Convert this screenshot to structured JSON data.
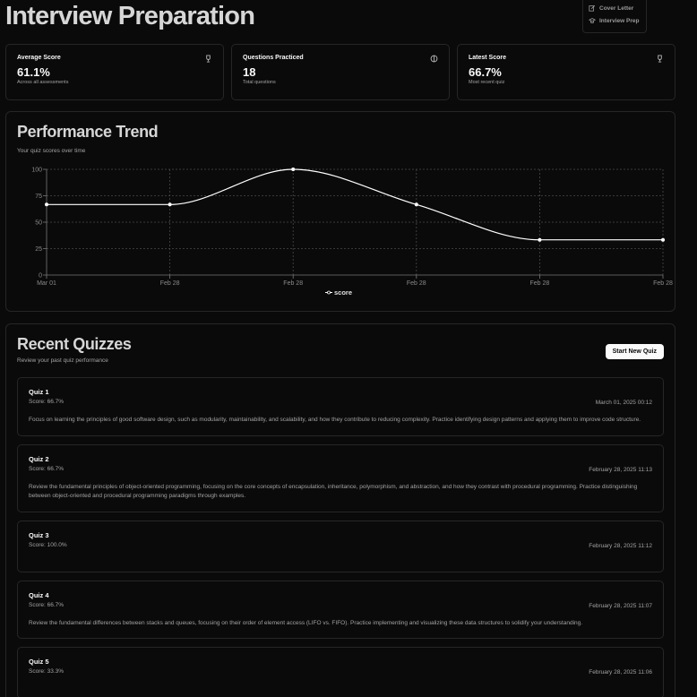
{
  "page": {
    "title": "Interview Preparation"
  },
  "nav_menu": {
    "items": [
      {
        "label": "Cover Letter",
        "icon": "edit-icon"
      },
      {
        "label": "Interview Prep",
        "icon": "graduation-cap-icon"
      }
    ]
  },
  "stats": [
    {
      "label": "Average Score",
      "value": "61.1%",
      "sub": "Across all assessments",
      "icon": "trophy-icon"
    },
    {
      "label": "Questions Practiced",
      "value": "18",
      "sub": "Total questions",
      "icon": "brain-icon"
    },
    {
      "label": "Latest Score",
      "value": "66.7%",
      "sub": "Most recent quiz",
      "icon": "trophy-icon"
    }
  ],
  "performance": {
    "title": "Performance Trend",
    "subtitle": "Your quiz scores over time"
  },
  "chart_data": {
    "type": "line",
    "x": [
      "Mar 01",
      "Feb 28",
      "Feb 28",
      "Feb 28",
      "Feb 28",
      "Feb 28"
    ],
    "series": [
      {
        "name": "score",
        "values": [
          66.7,
          66.7,
          100,
          66.7,
          33.3,
          33.3
        ]
      }
    ],
    "ylim": [
      0,
      100
    ],
    "yticks": [
      0,
      25,
      50,
      75,
      100
    ],
    "grid": true,
    "legend": "bottom-center",
    "line_color": "#ffffff"
  },
  "recent": {
    "title": "Recent Quizzes",
    "subtitle": "Review your past quiz performance",
    "button": "Start New Quiz",
    "quizzes": [
      {
        "name": "Quiz 1",
        "score": "Score: 66.7%",
        "date": "March 01, 2025 00:12",
        "desc": "Focus on learning the principles of good software design, such as modularity, maintainability, and scalability, and how they contribute to reducing complexity. Practice identifying design patterns and applying them to improve code structure."
      },
      {
        "name": "Quiz 2",
        "score": "Score: 66.7%",
        "date": "February 28, 2025 11:13",
        "desc": "Review the fundamental principles of object-oriented programming, focusing on the core concepts of encapsulation, inheritance, polymorphism, and abstraction, and how they contrast with procedural programming. Practice distinguishing between object-oriented and procedural programming paradigms through examples."
      },
      {
        "name": "Quiz 3",
        "score": "Score: 100.0%",
        "date": "February 28, 2025 11:12",
        "desc": ""
      },
      {
        "name": "Quiz 4",
        "score": "Score: 66.7%",
        "date": "February 28, 2025 11:07",
        "desc": "Review the fundamental differences between stacks and queues, focusing on their order of element access (LIFO vs. FIFO). Practice implementing and visualizing these data structures to solidify your understanding."
      },
      {
        "name": "Quiz 5",
        "score": "Score: 33.3%",
        "date": "February 28, 2025 11:06",
        "desc": ""
      }
    ]
  }
}
